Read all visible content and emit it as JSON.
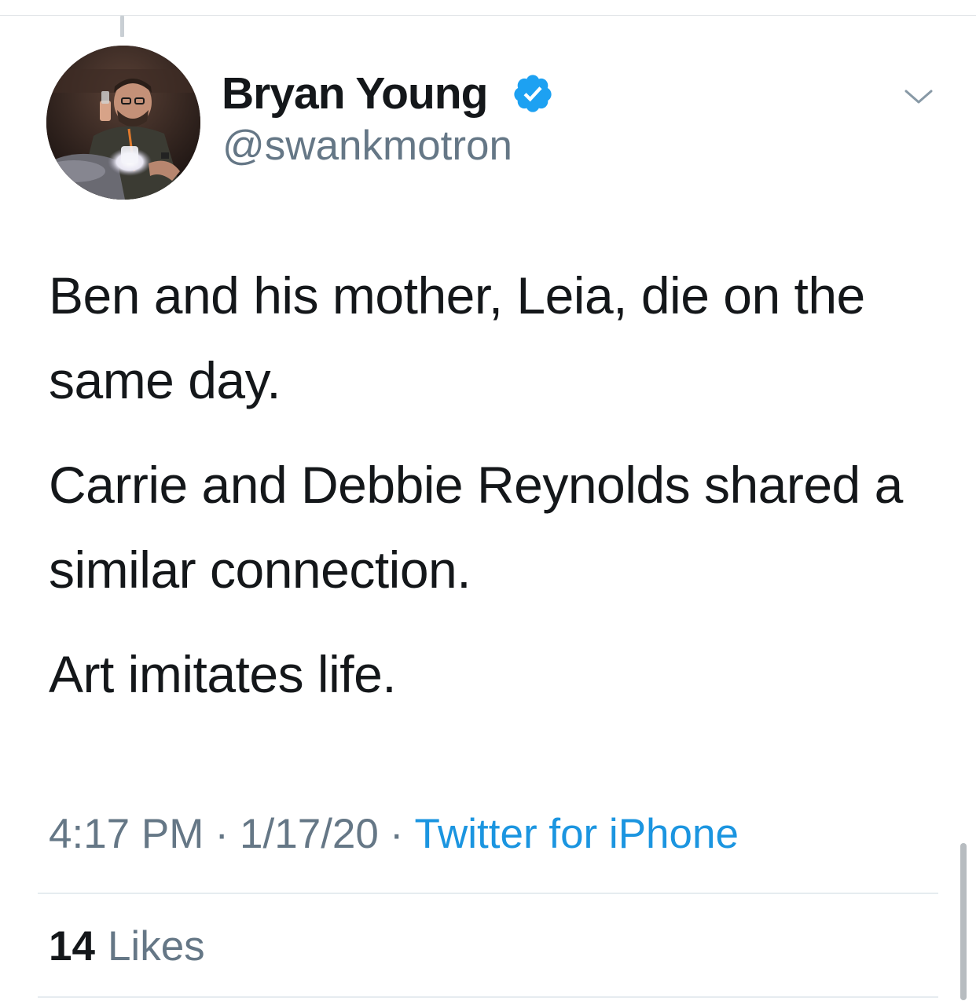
{
  "tweet": {
    "display_name": "Bryan Young",
    "handle": "@swankmotron",
    "verified": true,
    "avatar_icon": "user-avatar-photo",
    "menu_icon": "chevron-down-icon",
    "paragraphs": [
      "Ben and his mother, Leia, die on the same day.",
      "Carrie and Debbie Reynolds shared a similar connection.",
      "Art imitates life."
    ],
    "time": "4:17 PM",
    "separator": "·",
    "date": "1/17/20",
    "source": "Twitter for iPhone",
    "likes": {
      "count": "14",
      "label": "Likes"
    }
  },
  "colors": {
    "text": "#14171a",
    "secondary": "#657786",
    "link": "#1b95e0",
    "verified_badge": "#1da1f2",
    "divider": "#e6ecf0"
  }
}
